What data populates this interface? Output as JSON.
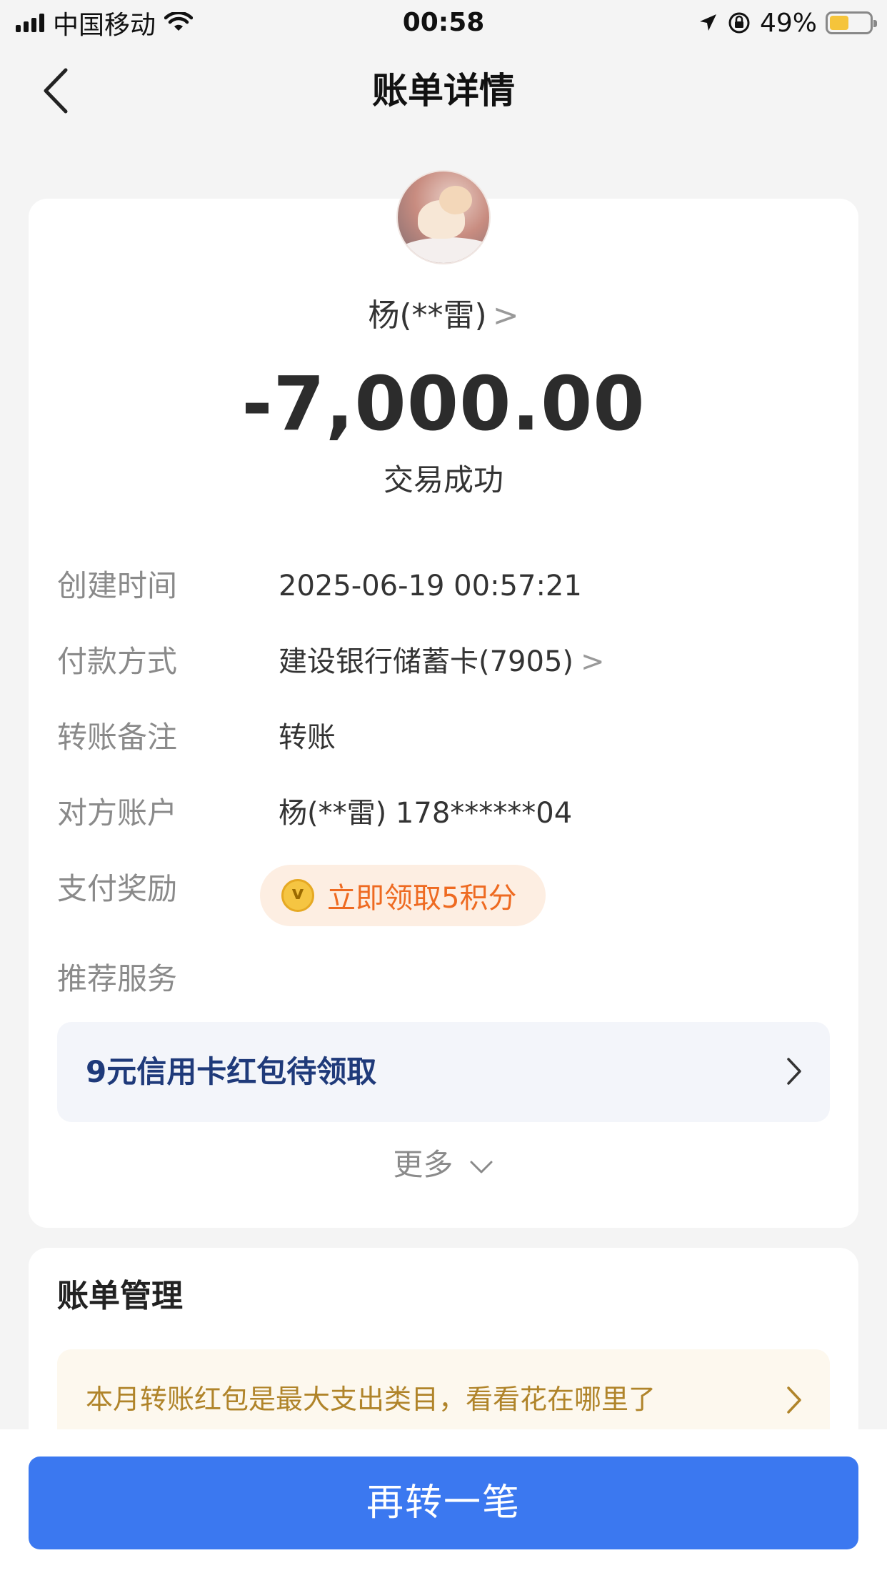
{
  "status_bar": {
    "carrier": "中国移动",
    "time": "00:58",
    "battery_percent": "49%",
    "battery_level": 0.49
  },
  "nav": {
    "title": "账单详情",
    "back_icon": "chevron-left-icon"
  },
  "summary": {
    "payee": "杨(**雷)",
    "amount": "-7,000.00",
    "status": "交易成功"
  },
  "details": {
    "created_label": "创建时间",
    "created_value": "2025-06-19 00:57:21",
    "payment_label": "付款方式",
    "payment_value": "建设银行储蓄卡(7905)",
    "memo_label": "转账备注",
    "memo_value": "转账",
    "account_label": "对方账户",
    "account_value": "杨(**雷) 178******04",
    "reward_label": "支付奖励",
    "reward_value": "立即领取5积分",
    "service_label": "推荐服务"
  },
  "service": {
    "text": "9元信用卡红包待领取"
  },
  "more": {
    "label": "更多"
  },
  "manage": {
    "title": "账单管理",
    "text": "本月转账红包是最大支出类目，看看花在哪里了"
  },
  "cta": {
    "label": "再转一笔"
  },
  "colors": {
    "primary": "#3b78f0",
    "reward_orange": "#ee6a21",
    "manage_gold": "#b0842a",
    "service_navy": "#1f3a7a"
  }
}
